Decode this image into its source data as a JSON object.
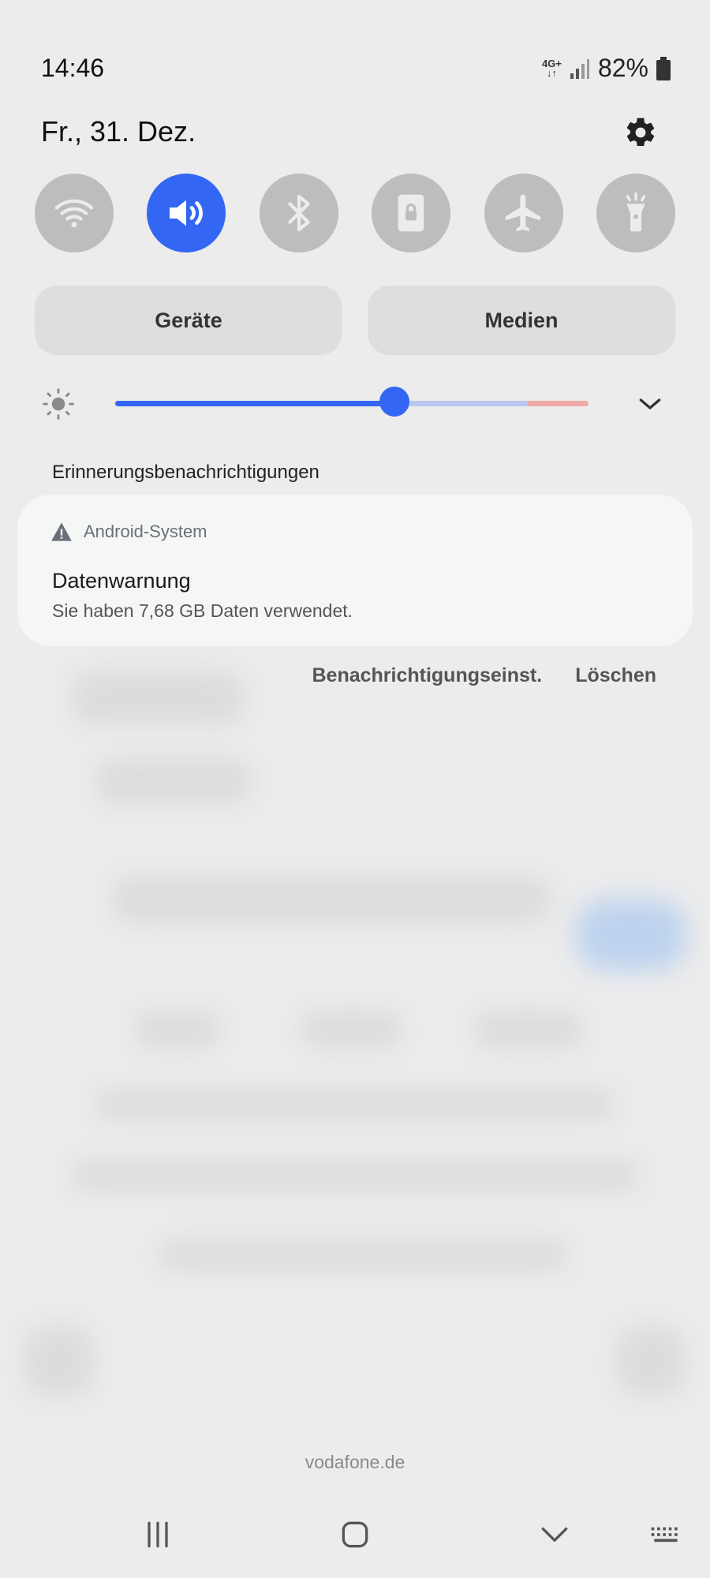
{
  "status": {
    "time": "14:46",
    "network": "4G+",
    "battery": "82%"
  },
  "header": {
    "date": "Fr., 31. Dez."
  },
  "quick_tiles": [
    {
      "icon": "wifi-icon",
      "active": false
    },
    {
      "icon": "sound-icon",
      "active": true
    },
    {
      "icon": "bluetooth-icon",
      "active": false
    },
    {
      "icon": "rotation-lock-icon",
      "active": false
    },
    {
      "icon": "airplane-icon",
      "active": false
    },
    {
      "icon": "flashlight-icon",
      "active": false
    }
  ],
  "buttons": {
    "devices": "Geräte",
    "media": "Medien"
  },
  "brightness": {
    "level": 0.59
  },
  "notifications": {
    "section_title": "Erinnerungsbenachrichtigungen",
    "card": {
      "app": "Android-System",
      "title": "Datenwarnung",
      "text": "Sie haben 7,68 GB Daten verwendet."
    },
    "actions": {
      "settings": "Benachrichtigungseinst.",
      "clear": "Löschen"
    }
  },
  "carrier": "vodafone.de",
  "colors": {
    "accent": "#3366f2",
    "tile_inactive": "#bdbdbd"
  }
}
